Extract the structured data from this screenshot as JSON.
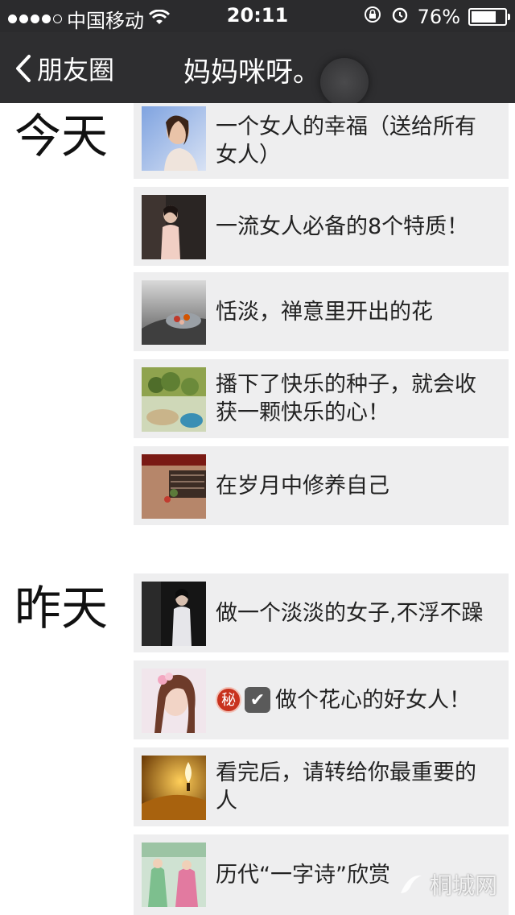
{
  "status": {
    "carrier": "中国移动",
    "time": "20:11",
    "battery": "76%",
    "battery_level": 0.76
  },
  "nav": {
    "back_label": "朋友圈",
    "title": "妈妈咪呀。"
  },
  "sections": [
    {
      "label": "今天",
      "items": [
        {
          "text": "一个女人的幸福（送给所有女人）"
        },
        {
          "text": "一流女人必备的8个特质！"
        },
        {
          "text": "恬淡，禅意里开出的花"
        },
        {
          "text": "播下了快乐的种子，就会收获一颗快乐的心！"
        },
        {
          "text": "在岁月中修养自己"
        }
      ]
    },
    {
      "label": "昨天",
      "items": [
        {
          "text": "做一个淡淡的女子,不浮不躁"
        },
        {
          "text": "做个花心的好女人！",
          "badge_secret": "秘",
          "badge_check": "✔"
        },
        {
          "text": "看完后，请转给你最重要的人"
        },
        {
          "text": "历代“一字诗”欣赏"
        }
      ]
    }
  ],
  "watermark": "桐城网",
  "colors": {
    "navbar": "#2e2e30",
    "item_bg": "#eeeeef",
    "badge_red": "#c8321e"
  }
}
